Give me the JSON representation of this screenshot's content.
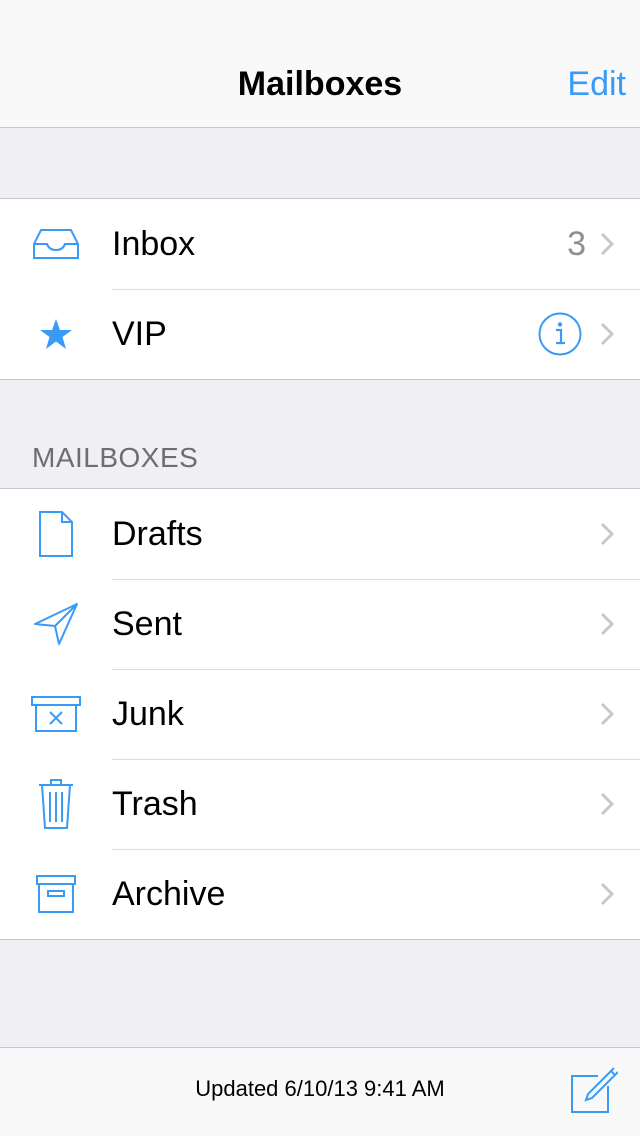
{
  "nav": {
    "title": "Mailboxes",
    "edit_label": "Edit"
  },
  "favorites": [
    {
      "label": "Inbox",
      "icon": "inbox-icon",
      "count": "3"
    },
    {
      "label": "VIP",
      "icon": "star-icon"
    }
  ],
  "mailboxes_header": "MAILBOXES",
  "mailboxes": [
    {
      "label": "Drafts",
      "icon": "drafts-icon"
    },
    {
      "label": "Sent",
      "icon": "sent-icon"
    },
    {
      "label": "Junk",
      "icon": "junk-icon"
    },
    {
      "label": "Trash",
      "icon": "trash-icon"
    },
    {
      "label": "Archive",
      "icon": "archive-icon"
    }
  ],
  "toolbar": {
    "status": "Updated 6/10/13 9:41 AM",
    "compose_icon": "compose-icon"
  },
  "colors": {
    "accent": "#3a9bf7",
    "background": "#efeff4",
    "separator": "#c8c7cc",
    "chevron": "#c7c7cc"
  }
}
